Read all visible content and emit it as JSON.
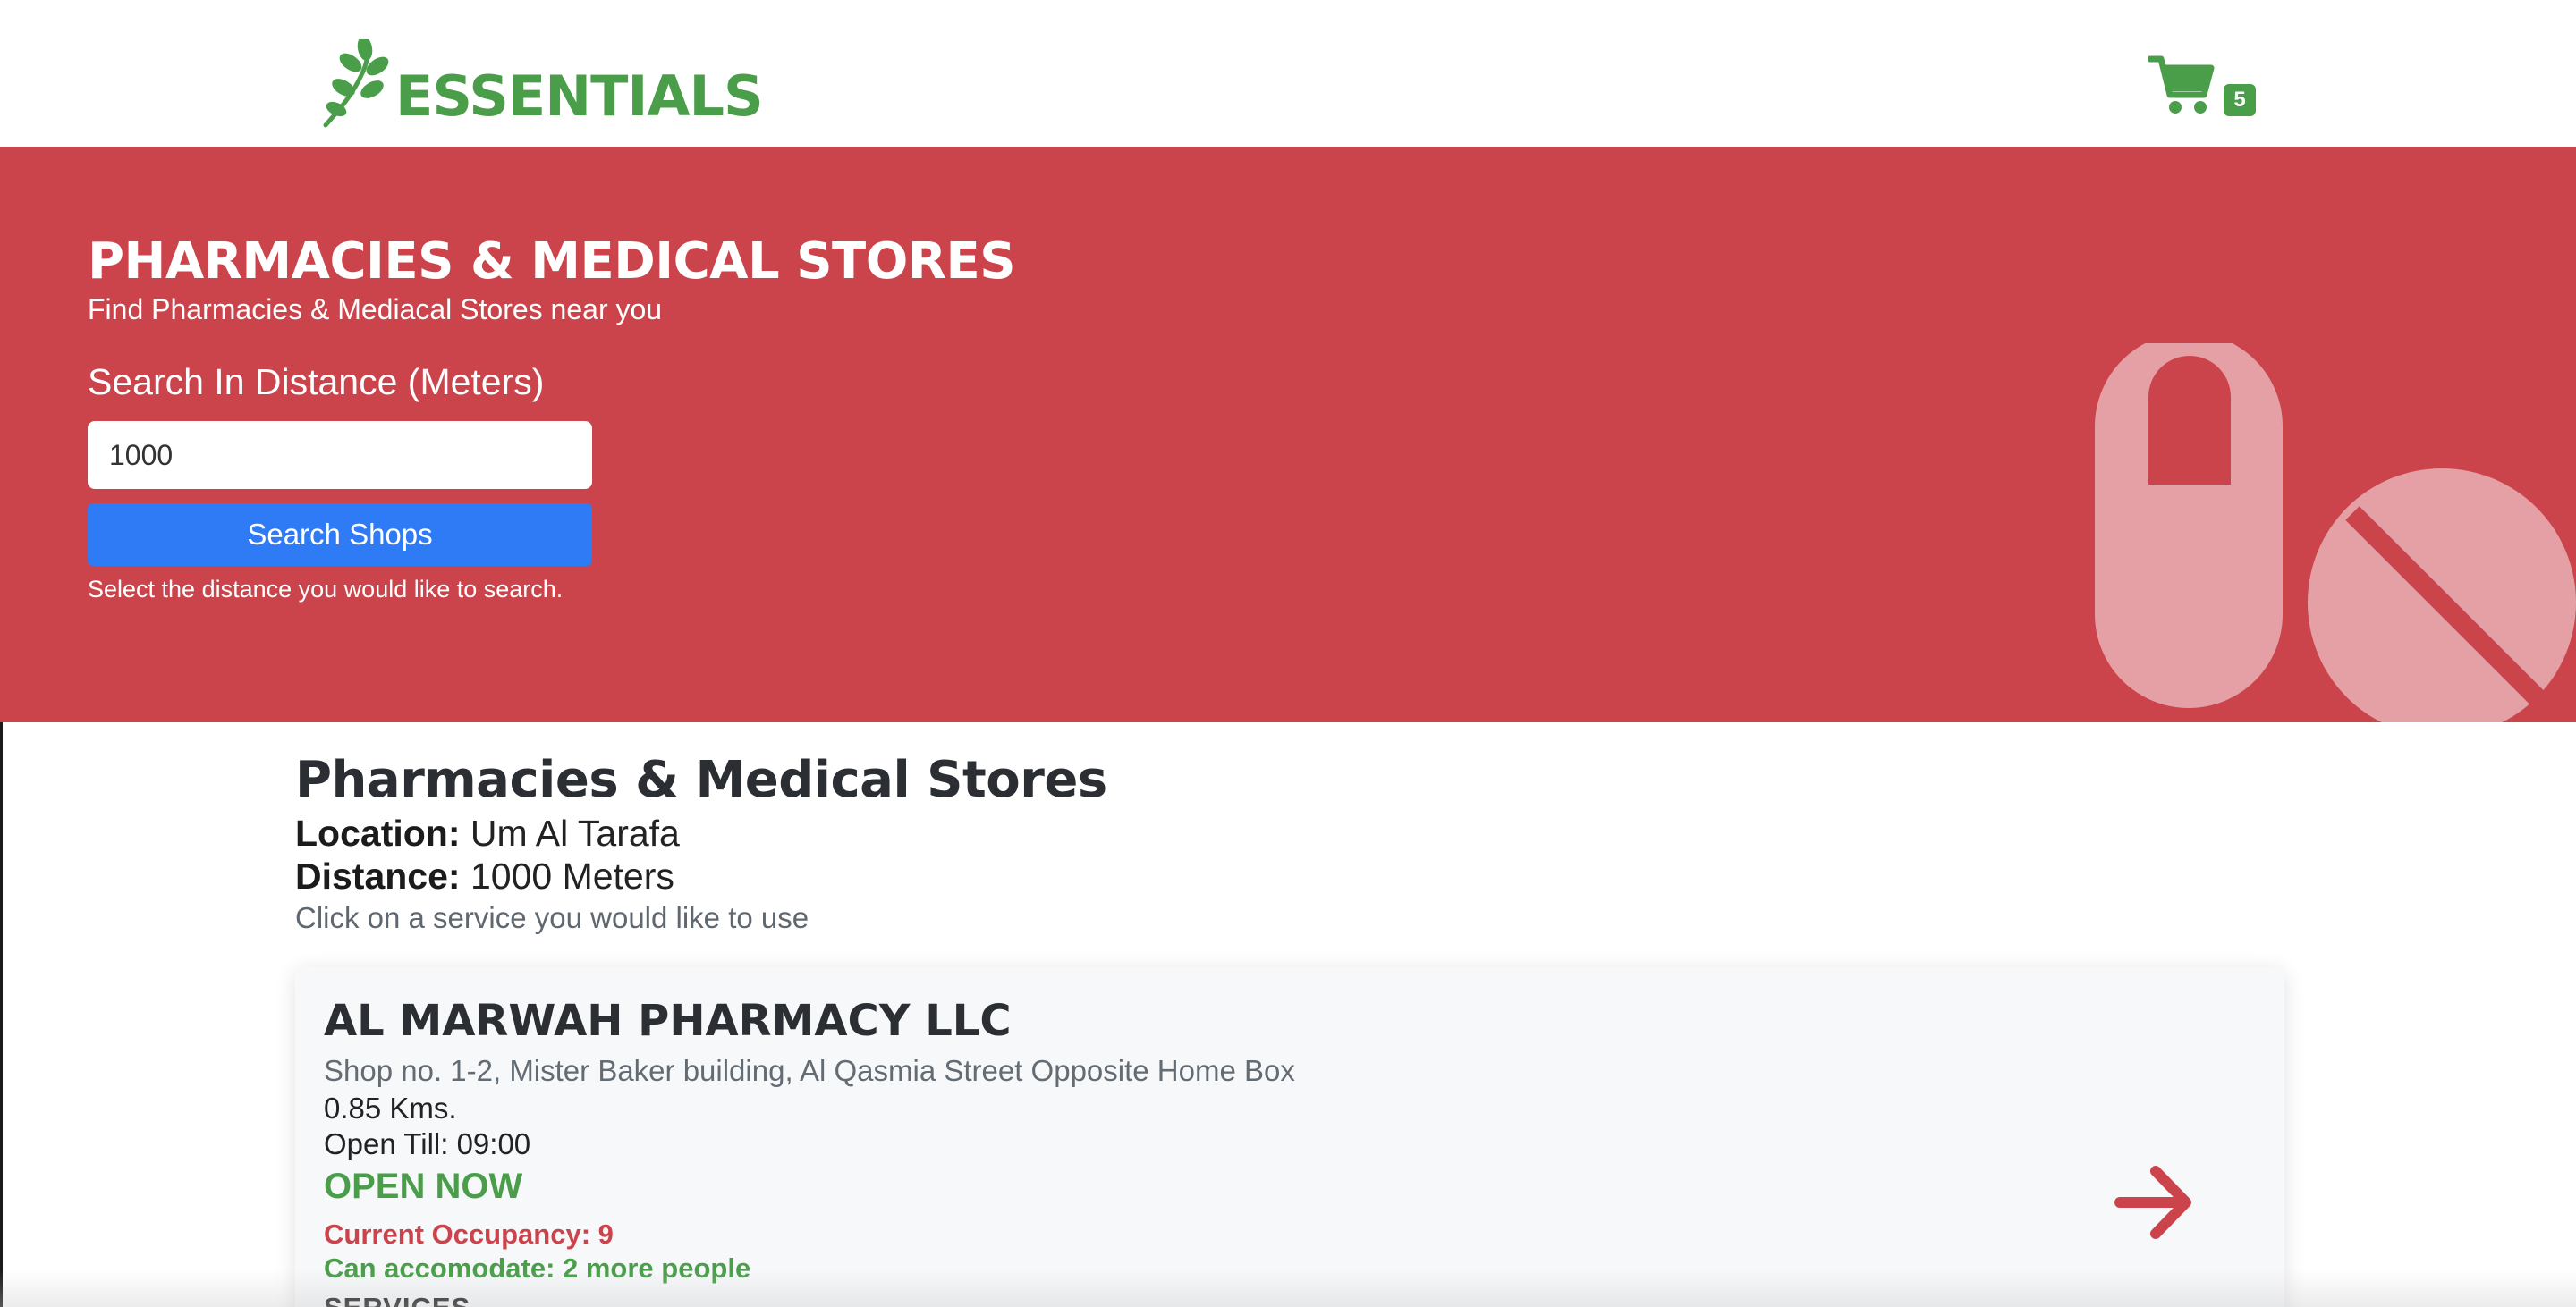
{
  "header": {
    "brand": "ESSENTIALS",
    "logo_icon": "leaf-icon",
    "cart_icon": "cart-icon",
    "cart_count": "5"
  },
  "hero": {
    "title": "PHARMACIES & MEDICAL STORES",
    "subtitle": "Find Pharmacies & Mediacal Stores near you",
    "distance_label": "Search In Distance (Meters)",
    "distance_value": "1000",
    "search_button": "Search Shops",
    "help_text": "Select the distance you would like to search.",
    "decor_icon": "pills-icon",
    "background_color": "#cb444c"
  },
  "results": {
    "title": "Pharmacies & Medical Stores",
    "location_label": "Location:",
    "location_value": "Um Al Tarafa",
    "distance_label": "Distance:",
    "distance_value": "1000 Meters",
    "hint": "Click on a service you would like to use"
  },
  "shops": [
    {
      "name": "AL MARWAH PHARMACY LLC",
      "address": "Shop no. 1-2, Mister Baker building, Al Qasmia Street Opposite Home Box",
      "distance": "0.85 Kms.",
      "open_till": "Open Till: 09:00",
      "status": "OPEN NOW",
      "occupancy": "Current Occupancy: 9",
      "capacity": "Can accomodate: 2 more people",
      "services_label": "SERVICES",
      "arrow_icon": "arrow-right-icon"
    }
  ],
  "colors": {
    "brand_green": "#4a9e4a",
    "hero_red": "#cb444c",
    "button_blue": "#2f7bf5"
  }
}
